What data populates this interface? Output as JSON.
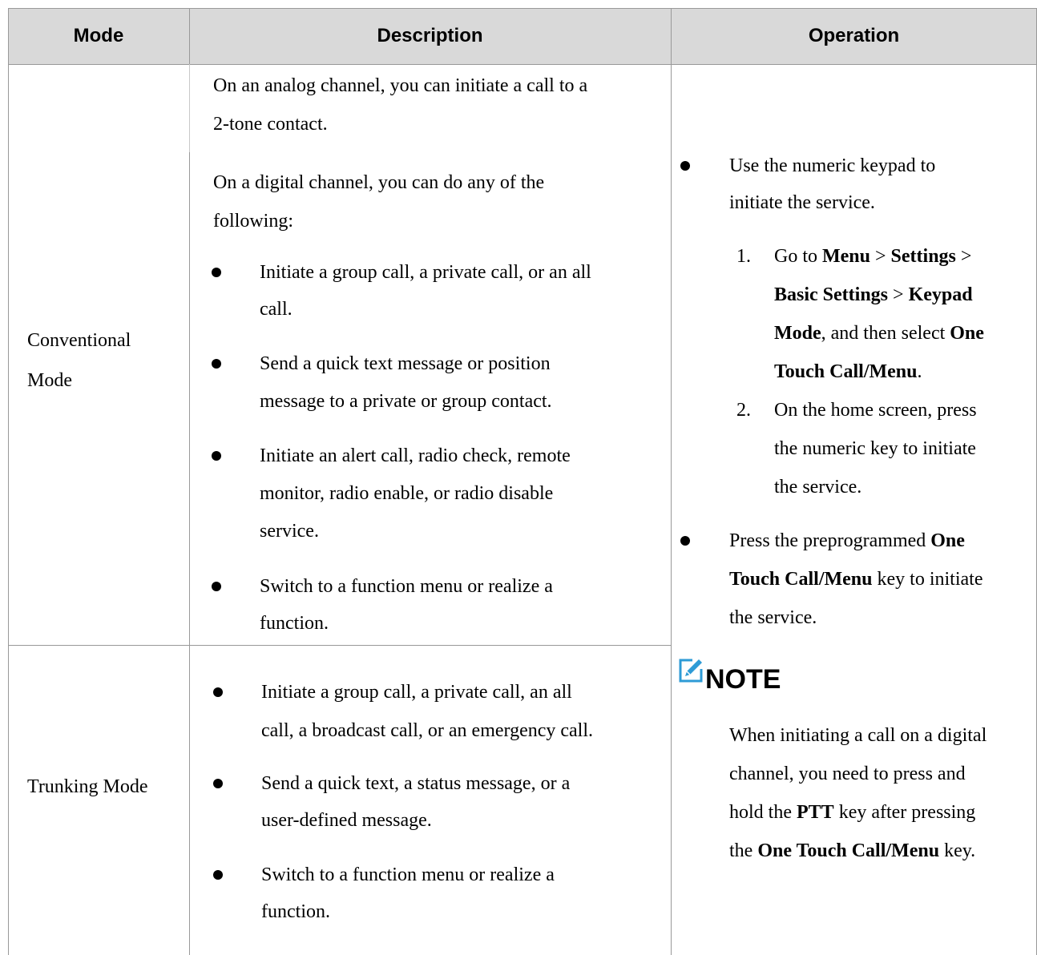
{
  "header": {
    "mode": "Mode",
    "description": "Description",
    "operation": "Operation"
  },
  "rows": {
    "conventional": {
      "mode_line1": "Conventional",
      "mode_line2": "Mode",
      "analog_line1": "On an analog channel, you can initiate a call to a",
      "analog_line2": "2-tone contact.",
      "digital_line1": "On a digital channel, you can do any of the",
      "digital_line2": "following:",
      "bullets": [
        {
          "line1": "Initiate a group call, a private call, or an all",
          "line2": "call."
        },
        {
          "line1": "Send a quick text message or position",
          "line2": "message to a private or group contact."
        },
        {
          "line1": "Initiate an alert call, radio check, remote",
          "line2": "monitor, radio enable, or radio disable",
          "line3": "service."
        },
        {
          "line1": "Switch to a function menu or realize a",
          "line2": "function."
        }
      ]
    },
    "trunking": {
      "mode_label": "Trunking Mode",
      "bullets": [
        {
          "line1": "Initiate a group call, a private call, an all",
          "line2": "call, a broadcast call, or an emergency call."
        },
        {
          "line1": "Send a quick text, a status message, or a",
          "line2": "user-defined message."
        },
        {
          "line1": "Switch to a function menu or realize a",
          "line2": "function."
        }
      ]
    }
  },
  "operation": {
    "b1_line1": "Use the numeric keypad to",
    "b1_line2": "initiate the service.",
    "step1": {
      "num": "1.",
      "go_to": "Go to ",
      "menu": "Menu",
      "gt": " > ",
      "settings": "Settings",
      "basic_settings": "Basic Settings",
      "keypad": "Keypad",
      "mode": "Mode",
      "then_select": ", and then select ",
      "one": "One",
      "touch_call_menu": "Touch Call/Menu",
      "period": "."
    },
    "step2": {
      "num": "2.",
      "line1": "On the home screen, press",
      "line2": "the numeric key to initiate",
      "line3": "the service."
    },
    "b2": {
      "press_the": "Press the preprogrammed ",
      "one": "One",
      "touch_call_menu": "Touch Call/Menu",
      "key_to_initiate": " key to initiate",
      "the_service": "the service."
    },
    "note": {
      "title": "NOTE",
      "line1": "When initiating a call on a digital",
      "line2": "channel, you need to press and",
      "line3_pre": "hold the ",
      "ptt": "PTT",
      "line3_post": " key after pressing",
      "line4_pre": "the ",
      "one_touch": "One Touch Call/Menu",
      "line4_post": " key."
    }
  },
  "colors": {
    "header_bg": "#d9d9d9",
    "border": "#999999",
    "note_icon": "#2e9bd6"
  },
  "icons": {
    "note": "note-edit-icon",
    "bullet": "bullet-dot"
  }
}
